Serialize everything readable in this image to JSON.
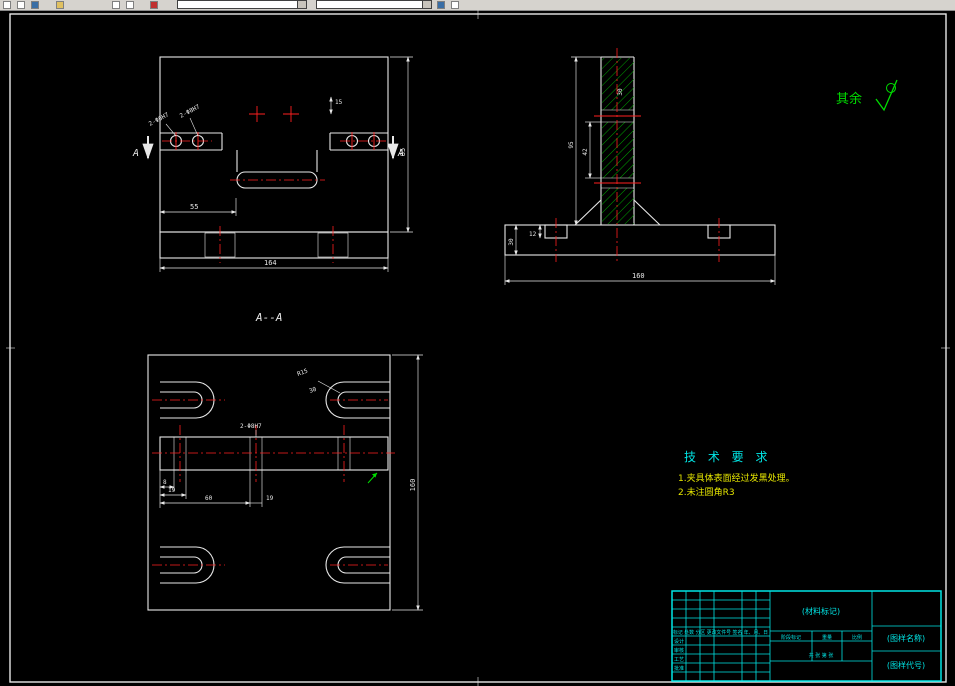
{
  "drawing": {
    "remainder_label": "其余",
    "section_mark_left": "A",
    "section_mark_right": "A",
    "section_title": "A--A",
    "tech": {
      "title": "技 术 要 求",
      "item1": "1.夹具体表面经过发黑处理。",
      "item2": "2.未注圆角R3"
    },
    "front": {
      "dim_55": "55",
      "dim_164": "164",
      "dim_85": "85",
      "dim_15": "15",
      "hole_note_1": "2-Φ6H7",
      "hole_note_2": "2-Φ8H7"
    },
    "side": {
      "dim_42": "42",
      "dim_95": "95",
      "dim_12": "12",
      "dim_30_col": "30",
      "dim_30_base": "30",
      "dim_160": "160"
    },
    "section": {
      "dim_8": "8",
      "dim_19a": "19",
      "dim_60": "60",
      "dim_19b": "19",
      "dim_160": "160",
      "radius_note": "R15",
      "dim_30": "30",
      "hole_note": "2-Φ8H7"
    },
    "title_block": {
      "material": "(材料标记)",
      "name": "(图样名称)",
      "code": "(图样代号)",
      "rev_header": "标记 处数 分区 更改文件号 签名 年、月、日",
      "sign_design": "设计",
      "sign_check": "审核",
      "sign_process": "工艺",
      "sign_approve": "批准",
      "stage": "阶段标记",
      "weight": "重量",
      "scale": "比例",
      "sheets": "共 张 第 张"
    }
  }
}
